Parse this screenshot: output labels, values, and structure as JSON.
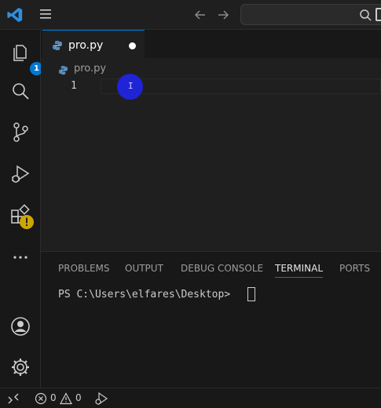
{
  "titlebar": {
    "app_icon": "vscode-logo-icon",
    "menu_icon": "hamburger-menu-icon",
    "search_icon": "search-icon"
  },
  "activity_bar": {
    "items": [
      {
        "name": "explorer",
        "icon": "files-icon",
        "badge": "1"
      },
      {
        "name": "search",
        "icon": "search-icon"
      },
      {
        "name": "source-control",
        "icon": "source-control-icon"
      },
      {
        "name": "run-and-debug",
        "icon": "run-debug-icon"
      },
      {
        "name": "extensions",
        "icon": "extensions-icon",
        "warning": true
      },
      {
        "name": "more",
        "icon": "ellipsis-icon"
      }
    ],
    "bottom_items": [
      {
        "name": "accounts",
        "icon": "account-icon"
      },
      {
        "name": "manage",
        "icon": "gear-icon"
      }
    ]
  },
  "editor": {
    "tab": {
      "label": "pro.py",
      "dirty": true
    },
    "breadcrumb": {
      "file": "pro.py"
    },
    "line_numbers": [
      "1"
    ],
    "cursor_indicator": "I"
  },
  "panel": {
    "tabs": [
      {
        "label": "PROBLEMS",
        "active": false
      },
      {
        "label": "OUTPUT",
        "active": false
      },
      {
        "label": "DEBUG CONSOLE",
        "active": false
      },
      {
        "label": "TERMINAL",
        "active": true
      },
      {
        "label": "PORTS",
        "active": false
      }
    ],
    "terminal_prompt": "PS C:\\Users\\elfares\\Desktop> "
  },
  "statusbar": {
    "errors": "0",
    "warnings": "0"
  },
  "colors": {
    "accent": "#0078d4",
    "background": "#181818",
    "editor_background": "#1f1f1f",
    "cursor_highlight": "#1f24d6"
  }
}
